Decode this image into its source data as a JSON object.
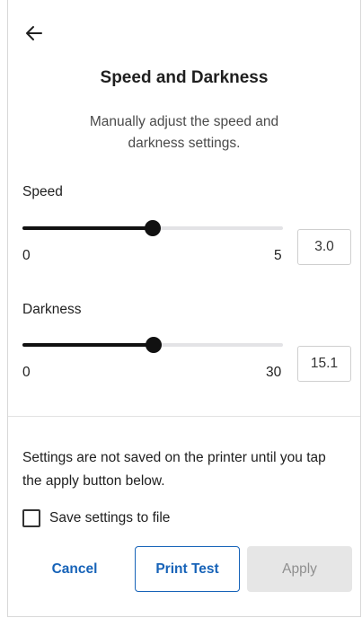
{
  "header": {
    "title": "Speed and Darkness",
    "subtitle": "Manually adjust the speed and darkness settings."
  },
  "speed": {
    "label": "Speed",
    "min": "0",
    "max": "5",
    "value": "3.0",
    "fraction": 0.5
  },
  "darkness": {
    "label": "Darkness",
    "min": "0",
    "max": "30",
    "value": "15.1",
    "fraction": 0.503
  },
  "notice": "Settings are not saved on the printer until you tap the apply button below.",
  "save_to_file": {
    "label": "Save settings to file",
    "checked": false
  },
  "buttons": {
    "cancel": "Cancel",
    "print_test": "Print Test",
    "apply": "Apply"
  },
  "colors": {
    "accent": "#1763b8",
    "slider_fill": "#111111",
    "slider_track": "#e3e3e6",
    "disabled_bg": "#e6e6e6",
    "disabled_text": "#8f8f8f"
  },
  "icons": {
    "back": "arrow-left-icon"
  }
}
